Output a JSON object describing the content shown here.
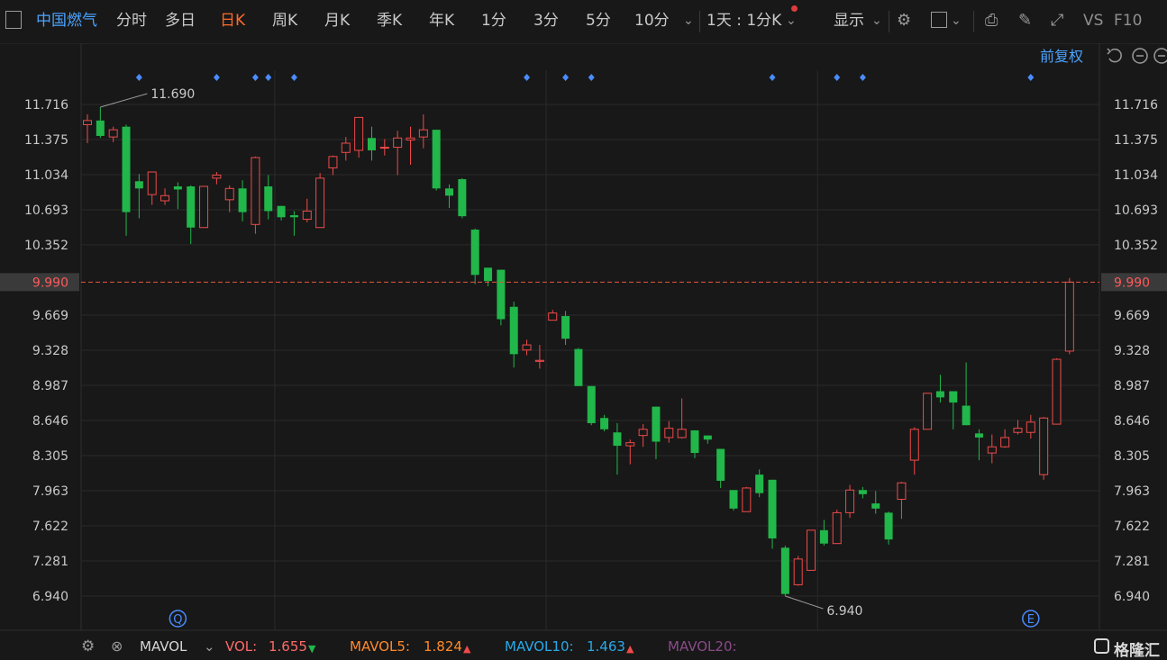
{
  "toolbar": {
    "stock_name": "中国燃气",
    "periods": [
      "分时",
      "多日",
      "日K",
      "周K",
      "月K",
      "季K",
      "年K",
      "1分",
      "3分",
      "5分",
      "10分"
    ],
    "active_period": "日K",
    "dropdown_label": "1天 : 1分K",
    "display_label": "显示",
    "vs_label": "VS",
    "f10_label": "F10",
    "adjust_label": "前复权"
  },
  "chart_data": {
    "type": "candlestick",
    "y_ticks": [
      11.716,
      11.375,
      11.034,
      10.693,
      10.352,
      9.99,
      9.669,
      9.328,
      8.987,
      8.646,
      8.305,
      7.963,
      7.622,
      7.281,
      6.94
    ],
    "ylim": [
      6.94,
      11.716
    ],
    "y_tick_labels": [
      "11.716",
      "11.375",
      "11.034",
      "10.693",
      "10.352",
      "9.990",
      "9.669",
      "9.328",
      "8.987",
      "8.646",
      "8.305",
      "7.963",
      "7.622",
      "7.281",
      "6.940"
    ],
    "current_price": 9.99,
    "current_price_label": "9.990",
    "max_label": "11.690",
    "min_label": "6.940",
    "max_index": 1,
    "min_index": 54,
    "up_color": "#ef4a4a",
    "down_color": "#21b74a",
    "candles": [
      {
        "o": 11.52,
        "h": 11.62,
        "l": 11.34,
        "c": 11.56
      },
      {
        "o": 11.56,
        "h": 11.69,
        "l": 11.39,
        "c": 11.41
      },
      {
        "o": 11.4,
        "h": 11.5,
        "l": 11.35,
        "c": 11.47
      },
      {
        "o": 11.5,
        "h": 11.52,
        "l": 10.44,
        "c": 10.67
      },
      {
        "o": 10.97,
        "h": 11.04,
        "l": 10.61,
        "c": 10.9
      },
      {
        "o": 10.84,
        "h": 11.06,
        "l": 10.74,
        "c": 11.06
      },
      {
        "o": 10.78,
        "h": 10.9,
        "l": 10.74,
        "c": 10.83
      },
      {
        "o": 10.92,
        "h": 10.96,
        "l": 10.7,
        "c": 10.89
      },
      {
        "o": 10.92,
        "h": 10.93,
        "l": 10.36,
        "c": 10.52
      },
      {
        "o": 10.52,
        "h": 10.92,
        "l": 10.52,
        "c": 10.92
      },
      {
        "o": 11.0,
        "h": 11.06,
        "l": 10.94,
        "c": 11.03
      },
      {
        "o": 10.79,
        "h": 10.93,
        "l": 10.67,
        "c": 10.9
      },
      {
        "o": 10.9,
        "h": 10.98,
        "l": 10.58,
        "c": 10.67
      },
      {
        "o": 10.55,
        "h": 11.21,
        "l": 10.46,
        "c": 11.2
      },
      {
        "o": 10.92,
        "h": 11.03,
        "l": 10.6,
        "c": 10.68
      },
      {
        "o": 10.73,
        "h": 10.73,
        "l": 10.59,
        "c": 10.62
      },
      {
        "o": 10.64,
        "h": 10.68,
        "l": 10.44,
        "c": 10.62
      },
      {
        "o": 10.6,
        "h": 10.8,
        "l": 10.57,
        "c": 10.68
      },
      {
        "o": 10.52,
        "h": 11.05,
        "l": 10.52,
        "c": 11.0
      },
      {
        "o": 11.1,
        "h": 11.22,
        "l": 11.03,
        "c": 11.21
      },
      {
        "o": 11.25,
        "h": 11.4,
        "l": 11.17,
        "c": 11.34
      },
      {
        "o": 11.27,
        "h": 11.5,
        "l": 11.2,
        "c": 11.59
      },
      {
        "o": 11.39,
        "h": 11.5,
        "l": 11.17,
        "c": 11.27
      },
      {
        "o": 11.3,
        "h": 11.38,
        "l": 11.22,
        "c": 11.3
      },
      {
        "o": 11.3,
        "h": 11.46,
        "l": 11.03,
        "c": 11.39
      },
      {
        "o": 11.37,
        "h": 11.5,
        "l": 11.13,
        "c": 11.39
      },
      {
        "o": 11.4,
        "h": 11.62,
        "l": 11.29,
        "c": 11.47
      },
      {
        "o": 11.47,
        "h": 11.47,
        "l": 10.88,
        "c": 10.9
      },
      {
        "o": 10.9,
        "h": 10.94,
        "l": 10.71,
        "c": 10.83
      },
      {
        "o": 10.99,
        "h": 11.0,
        "l": 10.61,
        "c": 10.63
      },
      {
        "o": 10.5,
        "h": 10.51,
        "l": 9.97,
        "c": 10.06
      },
      {
        "o": 10.13,
        "h": 10.13,
        "l": 9.95,
        "c": 10.0
      },
      {
        "o": 10.11,
        "h": 10.11,
        "l": 9.57,
        "c": 9.63
      },
      {
        "o": 9.75,
        "h": 9.8,
        "l": 9.16,
        "c": 9.29
      },
      {
        "o": 9.33,
        "h": 9.43,
        "l": 9.28,
        "c": 9.38
      },
      {
        "o": 9.22,
        "h": 9.38,
        "l": 9.15,
        "c": 9.23
      },
      {
        "o": 9.62,
        "h": 9.72,
        "l": 9.62,
        "c": 9.69
      },
      {
        "o": 9.66,
        "h": 9.71,
        "l": 9.38,
        "c": 9.44
      },
      {
        "o": 9.34,
        "h": 9.35,
        "l": 8.98,
        "c": 8.98
      },
      {
        "o": 8.98,
        "h": 8.98,
        "l": 8.6,
        "c": 8.62
      },
      {
        "o": 8.67,
        "h": 8.7,
        "l": 8.54,
        "c": 8.56
      },
      {
        "o": 8.53,
        "h": 8.62,
        "l": 8.12,
        "c": 8.4
      },
      {
        "o": 8.4,
        "h": 8.46,
        "l": 8.22,
        "c": 8.43
      },
      {
        "o": 8.5,
        "h": 8.61,
        "l": 8.39,
        "c": 8.56
      },
      {
        "o": 8.78,
        "h": 8.78,
        "l": 8.27,
        "c": 8.44
      },
      {
        "o": 8.48,
        "h": 8.64,
        "l": 8.43,
        "c": 8.57
      },
      {
        "o": 8.48,
        "h": 8.86,
        "l": 8.47,
        "c": 8.56
      },
      {
        "o": 8.55,
        "h": 8.55,
        "l": 8.28,
        "c": 8.33
      },
      {
        "o": 8.5,
        "h": 8.5,
        "l": 8.42,
        "c": 8.46
      },
      {
        "o": 8.37,
        "h": 8.37,
        "l": 7.99,
        "c": 8.06
      },
      {
        "o": 7.97,
        "h": 7.97,
        "l": 7.77,
        "c": 7.79
      },
      {
        "o": 7.76,
        "h": 8.0,
        "l": 7.76,
        "c": 7.99
      },
      {
        "o": 8.12,
        "h": 8.17,
        "l": 7.9,
        "c": 7.94
      },
      {
        "o": 8.07,
        "h": 8.07,
        "l": 7.4,
        "c": 7.5
      },
      {
        "o": 7.41,
        "h": 7.43,
        "l": 6.94,
        "c": 6.96
      },
      {
        "o": 7.05,
        "h": 7.33,
        "l": 7.04,
        "c": 7.3
      },
      {
        "o": 7.19,
        "h": 7.58,
        "l": 7.19,
        "c": 7.58
      },
      {
        "o": 7.58,
        "h": 7.68,
        "l": 7.43,
        "c": 7.45
      },
      {
        "o": 7.45,
        "h": 7.78,
        "l": 7.45,
        "c": 7.75
      },
      {
        "o": 7.75,
        "h": 8.02,
        "l": 7.7,
        "c": 7.97
      },
      {
        "o": 7.97,
        "h": 8.0,
        "l": 7.89,
        "c": 7.93
      },
      {
        "o": 7.84,
        "h": 7.96,
        "l": 7.74,
        "c": 7.79
      },
      {
        "o": 7.75,
        "h": 7.76,
        "l": 7.44,
        "c": 7.49
      },
      {
        "o": 7.88,
        "h": 8.05,
        "l": 7.69,
        "c": 8.04
      },
      {
        "o": 8.26,
        "h": 8.58,
        "l": 8.12,
        "c": 8.56
      },
      {
        "o": 8.56,
        "h": 8.91,
        "l": 8.56,
        "c": 8.91
      },
      {
        "o": 8.93,
        "h": 9.09,
        "l": 8.82,
        "c": 8.87
      },
      {
        "o": 8.93,
        "h": 8.93,
        "l": 8.56,
        "c": 8.82
      },
      {
        "o": 8.79,
        "h": 9.21,
        "l": 8.6,
        "c": 8.6
      },
      {
        "o": 8.52,
        "h": 8.56,
        "l": 8.26,
        "c": 8.48
      },
      {
        "o": 8.33,
        "h": 8.51,
        "l": 8.23,
        "c": 8.39
      },
      {
        "o": 8.39,
        "h": 8.56,
        "l": 8.38,
        "c": 8.48
      },
      {
        "o": 8.53,
        "h": 8.65,
        "l": 8.51,
        "c": 8.57
      },
      {
        "o": 8.53,
        "h": 8.7,
        "l": 8.47,
        "c": 8.63
      },
      {
        "o": 8.12,
        "h": 8.68,
        "l": 8.07,
        "c": 8.67
      },
      {
        "o": 8.61,
        "h": 9.25,
        "l": 8.61,
        "c": 9.24
      },
      {
        "o": 9.32,
        "h": 10.03,
        "l": 9.29,
        "c": 9.99
      }
    ],
    "event_markers_top": [
      4,
      10,
      13,
      14,
      16,
      34,
      37,
      39,
      53,
      58,
      60,
      73
    ],
    "vertical_grid_after_index": [
      14,
      35,
      56
    ],
    "event_marks_bottom": [
      {
        "index": 7,
        "label": "Q"
      },
      {
        "index": 73,
        "label": "E"
      }
    ]
  },
  "indicator": {
    "name": "MAVOL",
    "items": [
      {
        "label": "VOL:",
        "value": "1.655",
        "arrow": "down",
        "label_color": "#ff6a6a",
        "value_color": "#ff6a6a",
        "arrow_color": "#21b74a"
      },
      {
        "label": "MAVOL5:",
        "value": "1.824",
        "arrow": "up",
        "label_color": "#ff8a2b",
        "value_color": "#ff8a2b",
        "arrow_color": "#ef4a4a"
      },
      {
        "label": "MAVOL10:",
        "value": "1.463",
        "arrow": "up",
        "label_color": "#29a9e8",
        "value_color": "#29a9e8",
        "arrow_color": "#ef4a4a"
      },
      {
        "label": "MAVOL20:",
        "value": "",
        "arrow": "",
        "label_color": "#8a4b8a",
        "value_color": "#8a4b8a",
        "arrow_color": ""
      }
    ]
  },
  "brand": {
    "name": "格隆汇"
  },
  "icons": [
    "gear-icon",
    "close-icon",
    "camera-icon",
    "pencil-icon",
    "expand-icon",
    "undo-icon",
    "minus-circle-icon",
    "plus-circle-icon",
    "chevron-down-icon"
  ]
}
